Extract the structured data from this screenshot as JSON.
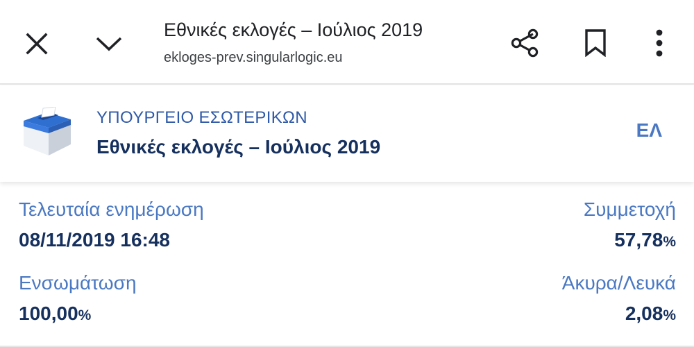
{
  "browser": {
    "title": "Εθνικές εκλογές – Ιούλιος 2019",
    "url": "ekloges-prev.singularlogic.eu",
    "icons": {
      "close": "close-icon",
      "collapse": "chevron-down-icon",
      "share": "share-icon",
      "bookmark": "bookmark-icon",
      "menu": "more-vert-icon"
    }
  },
  "header": {
    "ministry": "ΥΠΟΥΡΓΕΙΟ ΕΣΩΤΕΡΙΚΩΝ",
    "election_title": "Εθνικές εκλογές – Ιούλιος 2019",
    "language": "ΕΛ",
    "logo_icon": "ballot-box-icon"
  },
  "stats": {
    "last_update": {
      "label": "Τελευταία ενημέρωση",
      "value": "08/11/2019 16:48"
    },
    "turnout": {
      "label": "Συμμετοχή",
      "value": "57,78",
      "unit": "%"
    },
    "integration": {
      "label": "Ενσωμάτωση",
      "value": "100,00",
      "unit": "%"
    },
    "invalid_blank": {
      "label": "Άκυρα/Λευκά",
      "value": "2,08",
      "unit": "%"
    }
  },
  "colors": {
    "accent": "#4a78c2",
    "dark_blue": "#16305e",
    "ministry_blue": "#2f5aa8"
  }
}
